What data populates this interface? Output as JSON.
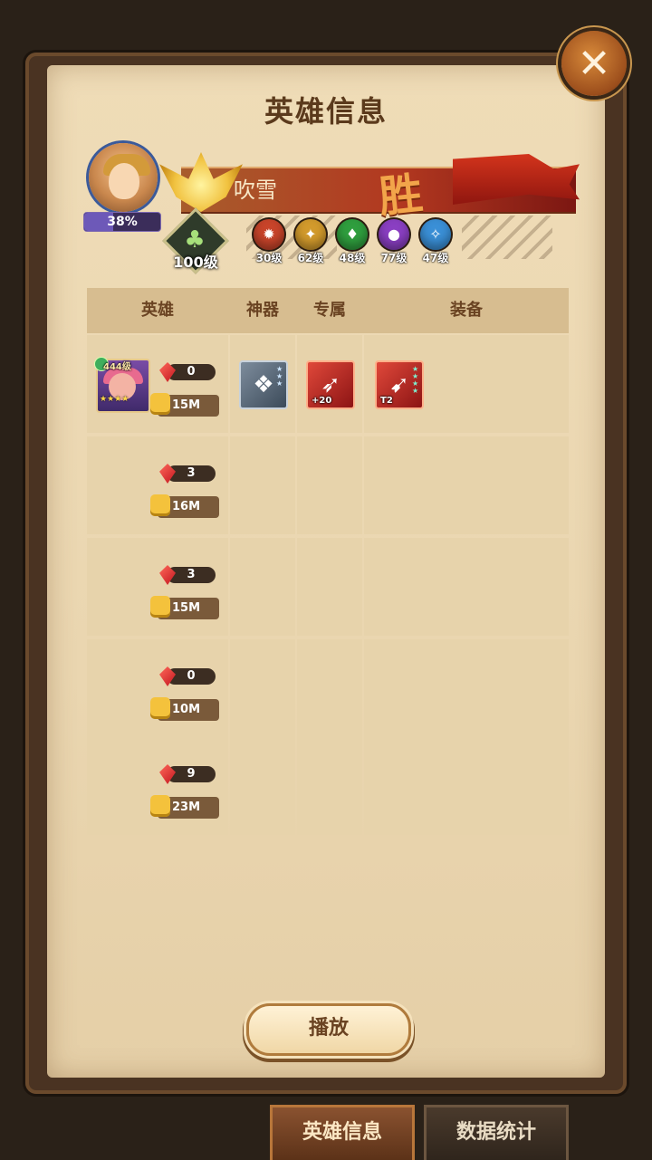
{
  "dialog": {
    "title": "英雄信息",
    "close_label": "✕"
  },
  "player": {
    "name": "吹雪",
    "progress_label": "38%",
    "progress": 0.38,
    "result": "胜",
    "level_label": "100级"
  },
  "factions": [
    {
      "level": "30级",
      "color": "#c8442a",
      "icon": "lightbearer-icon"
    },
    {
      "level": "62级",
      "color": "#d29a2c",
      "icon": "mauler-icon"
    },
    {
      "level": "48级",
      "color": "#2f9e3e",
      "icon": "wilder-icon"
    },
    {
      "level": "77级",
      "color": "#8a3fc2",
      "icon": "graveborn-icon"
    },
    {
      "level": "47级",
      "color": "#3a8fd6",
      "icon": "celestial-icon"
    }
  ],
  "table": {
    "headers": {
      "hero": "英雄",
      "artifact": "神器",
      "exclusive": "专属",
      "equipment": "装备"
    },
    "rows": [
      {
        "gems": "0",
        "power": "15M",
        "hero": {
          "level": "444级",
          "stars": "★★★★"
        },
        "artifact": {
          "icon": "artifact-icon"
        },
        "exclusive": {
          "icon": "bow-icon",
          "tag": "+20"
        },
        "equipment": {
          "icon": "crossbow-icon",
          "tag": "T2"
        }
      },
      {
        "gems": "3",
        "power": "16M"
      },
      {
        "gems": "3",
        "power": "15M"
      },
      {
        "gems": "0",
        "power": "10M"
      },
      {
        "gems": "9",
        "power": "23M"
      }
    ]
  },
  "actions": {
    "play_label": "播放"
  },
  "tabs": [
    {
      "label": "英雄信息",
      "active": true
    },
    {
      "label": "数据统计",
      "active": false
    }
  ]
}
